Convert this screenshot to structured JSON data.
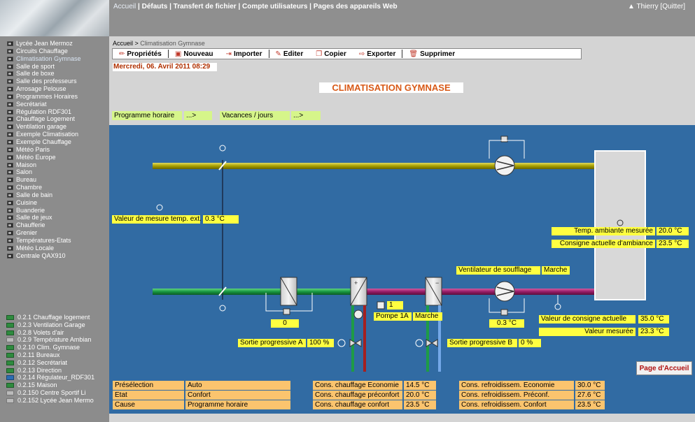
{
  "topbar": {
    "menu": [
      "Accueil",
      "Défauts",
      "Transfert de fichier",
      "Compte utilisateurs",
      "Pages des appareils Web"
    ],
    "user": "Thierry",
    "logout": "[Quitter]"
  },
  "sidebar": {
    "items": [
      "Lycée Jean Mermoz",
      "Circuits Chauffage",
      "Climatisation Gymnase",
      "Salle de sport",
      "Salle de boxe",
      "Salle des professeurs",
      "Arrosage Pelouse",
      "Programmes Horaires",
      "Secrétariat",
      "Régulation RDF301",
      "Chauffage Logement",
      "Ventilation garage",
      "Exemple Climatisation",
      "Exemple Chauffage",
      "Météo Paris",
      "Météo Europe",
      "Maison",
      "Salon",
      "Bureau",
      "Chambre",
      "Salle de bain",
      "Cuisine",
      "Buanderie",
      "Salle de jeux",
      "Chaufferie",
      "Grenier",
      "Températures-Etats",
      "Météo Locale",
      "Centrale QAX910"
    ],
    "plants": [
      "0.2.1 Chauffage logement",
      "0.2.3 Ventilation Garage",
      "0.2.8 Volets d'air",
      "0.2.9 Température Ambian",
      "0.2.10 Clim. Gymnase",
      "0.2.11 Bureaux",
      "0.2.12 Secrétariat",
      "0.2.13 Direction",
      "0.2.14 Régulateur_RDF301",
      "0.2.15 Maison",
      "0.2.150 Centre Sportif Li",
      "0.2.152 Lycée Jean Mermo"
    ]
  },
  "breadcrumb": {
    "home": "Accueil",
    "sep": " > ",
    "current": "Climatisation Gymnase"
  },
  "toolbar": {
    "props": "Propriétés",
    "new": "Nouveau",
    "import": "Importer",
    "edit": "Editer",
    "copy": "Copier",
    "export": "Exporter",
    "delete": "Supprimer"
  },
  "datetime": "Mercredi, 06. Avril 2011 08:29",
  "title": "CLIMATISATION GYMNASE",
  "links": {
    "schedule": "Programme horaire",
    "schedule_arrow": "...>",
    "holidays": "Vacances / jours",
    "holidays_arrow": "...>"
  },
  "values": {
    "ext_temp_label": "Valeur de mesure temp. ext.",
    "ext_temp": "0.3 °C",
    "room_temp_label": "Temp. ambiante mesurée",
    "room_temp": "20.0 °C",
    "room_setpoint_label": "Consigne actuelle d'ambiance",
    "room_setpoint": "23.5 °C",
    "fan_label": "Ventilateur de soufflage",
    "fan_state": "Marche",
    "pump_num": "1",
    "pump_label": "Pompe 1A",
    "pump_state": "Marche",
    "damper_val": "0",
    "supply_dp_val": "0.3 °C",
    "supply_setpoint_label": "Valeur de consigne actuelle",
    "supply_setpoint": "35.0 °C",
    "measured_label": "Valeur mesurée",
    "measured": "23.3 °C",
    "valve_a_label": "Sortie progressive A",
    "valve_a": "100 %",
    "valve_b_label": "Sortie progressive B",
    "valve_b": "0 %"
  },
  "home_button": "Page d'Accueil",
  "status": [
    {
      "label": "Présélection",
      "value": "Auto"
    },
    {
      "label": "Etat",
      "value": "Confort"
    },
    {
      "label": "Cause",
      "value": "Programme horaire"
    }
  ],
  "heating": [
    {
      "label": "Cons. chauffage Economie",
      "value": "14.5 °C"
    },
    {
      "label": "Cons. chauffage préconfort",
      "value": "20.0 °C"
    },
    {
      "label": "Cons. chauffage confort",
      "value": "23.5 °C"
    }
  ],
  "cooling": [
    {
      "label": "Cons. refroidissem. Economie",
      "value": "30.0 °C"
    },
    {
      "label": "Cons. refroidissem. Préconf.",
      "value": "27.6 °C"
    },
    {
      "label": "Cons. refroidissem. Confort",
      "value": "23.5 °C"
    }
  ],
  "colors": {
    "diagram_bg": "#316ba3",
    "value_box": "#ffff40",
    "link_box": "#d6f58a",
    "table_box": "#fbc46e",
    "exhaust_duct": "#b8b000",
    "fresh_duct": "#1e9b46",
    "supply_duct": "#9c1e6e"
  }
}
